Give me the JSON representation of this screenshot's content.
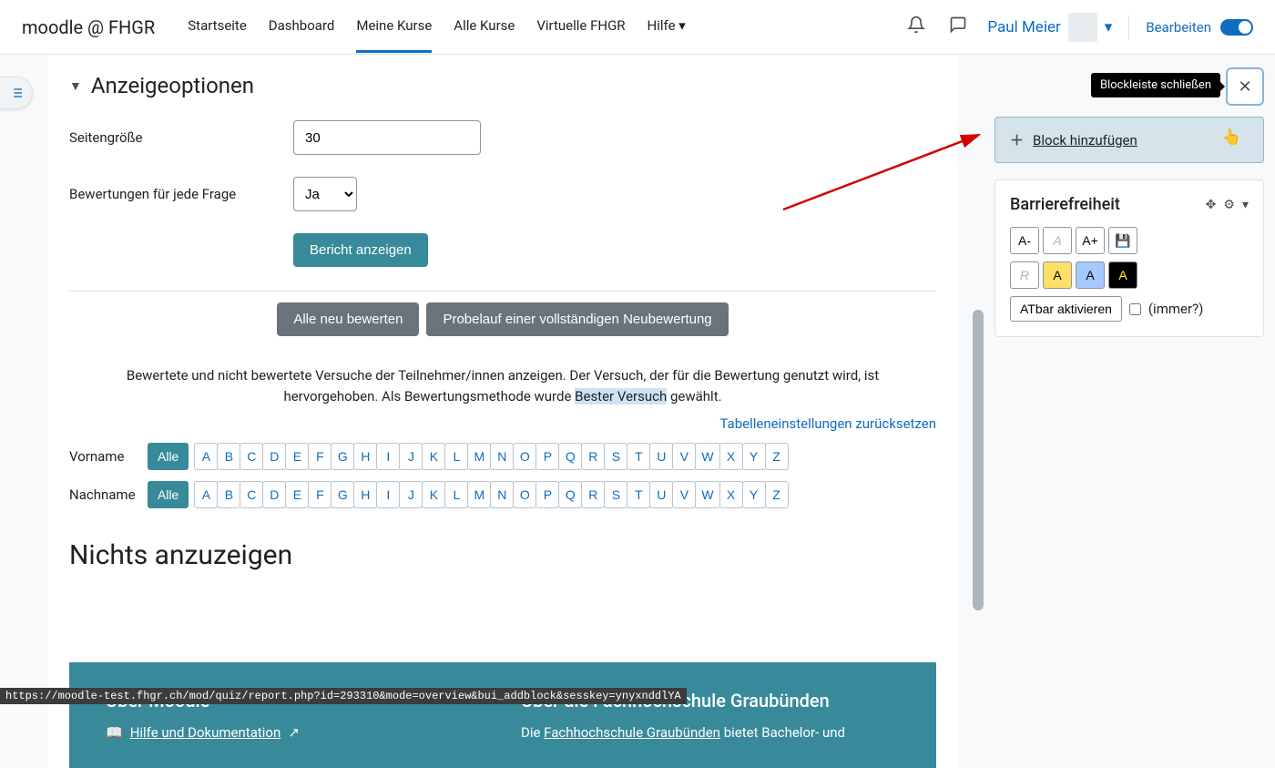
{
  "brand": "moodle @ FHGR",
  "nav": {
    "start": "Startseite",
    "dashboard": "Dashboard",
    "mycourses": "Meine Kurse",
    "allcourses": "Alle Kurse",
    "virtuelle": "Virtuelle FHGR",
    "help": "Hilfe"
  },
  "user": {
    "name": "Paul Meier",
    "edit": "Bearbeiten"
  },
  "section_title": "Anzeigeoptionen",
  "form": {
    "pagesize_label": "Seitengröße",
    "pagesize_value": "30",
    "grades_label": "Bewertungen für jede Frage",
    "grades_value": "Ja",
    "submit": "Bericht anzeigen"
  },
  "actions": {
    "regrade_all": "Alle neu bewerten",
    "dry_run": "Probelauf einer vollständigen Neubewertung"
  },
  "info_text_a": "Bewertete und nicht bewertete Versuche der Teilnehmer/innen anzeigen. Der Versuch, der für die Bewertung genutzt wird, ist hervorgehoben. Als Bewertungsmethode wurde ",
  "info_hl": "Bester Versuch",
  "info_text_b": " gewählt.",
  "reset_link": "Tabelleneinstellungen zurücksetzen",
  "firstname": "Vorname",
  "lastname": "Nachname",
  "all": "Alle",
  "letters": [
    "A",
    "B",
    "C",
    "D",
    "E",
    "F",
    "G",
    "H",
    "I",
    "J",
    "K",
    "L",
    "M",
    "N",
    "O",
    "P",
    "Q",
    "R",
    "S",
    "T",
    "U",
    "V",
    "W",
    "X",
    "Y",
    "Z"
  ],
  "nothing": "Nichts anzuzeigen",
  "footer": {
    "about_moodle": "Über Moodle",
    "help_doc": "Hilfe und Dokumentation",
    "about_fhgr": "Über die Fachhochschule Graubünden",
    "fhgr_text_a": "Die ",
    "fhgr_link": "Fachhochschule Graubünden",
    "fhgr_text_b": " bietet Bachelor- und"
  },
  "tooltip": "Blockleiste schließen",
  "add_block": "Block hinzufügen",
  "acc_block": {
    "title": "Barrierefreiheit",
    "aminus": "A-",
    "a": "A",
    "aplus": "A+",
    "r": "R",
    "atbar": "ATbar aktivieren",
    "always": "(immer?)"
  },
  "status": "https://moodle-test.fhgr.ch/mod/quiz/report.php?id=293310&mode=overview&bui_addblock&sesskey=ynyxnddlYA"
}
